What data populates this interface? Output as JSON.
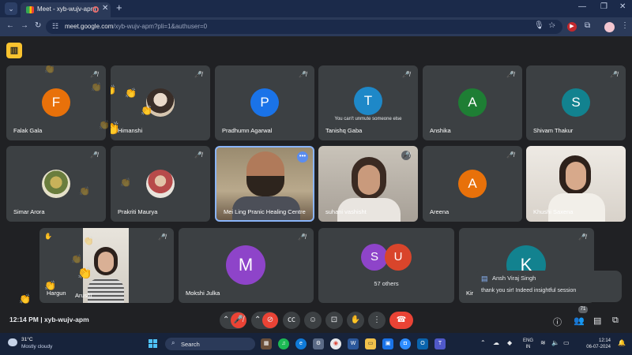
{
  "browser": {
    "tab_title": "Meet - xyb-wujv-apm",
    "url_host": "meet.google.com",
    "url_path": "/xyb-wujv-apm?pli=1&authuser=0"
  },
  "tiles": [
    {
      "id": "falak",
      "name": "Falak Gala",
      "initial": "F",
      "color": "#e8710a"
    },
    {
      "id": "himanshi",
      "name": "Himanshi"
    },
    {
      "id": "pradhumn",
      "name": "Pradhumn Agarwal",
      "initial": "P",
      "color": "#1a73e8"
    },
    {
      "id": "tanishq",
      "name": "Tanishq Gaba",
      "initial": "T",
      "color": "#1e88c8",
      "overlay": "You can't unmute someone else"
    },
    {
      "id": "anshika",
      "name": "Anshika",
      "initial": "A",
      "color": "#1e7e34"
    },
    {
      "id": "shivam",
      "name": "Shivam Thakur",
      "initial": "S",
      "color": "#12828f"
    },
    {
      "id": "simar",
      "name": "Simar Arora"
    },
    {
      "id": "prakriti",
      "name": "Prakriti Maurya"
    },
    {
      "id": "mei",
      "name": "Mei Ling Pranic Healing Centre"
    },
    {
      "id": "suhani",
      "name": "suhani vashisht"
    },
    {
      "id": "areena",
      "name": "Areena",
      "initial": "A",
      "color": "#e8710a"
    },
    {
      "id": "khushi",
      "name": "Khushi Saxena"
    },
    {
      "id": "hargun",
      "name": "Hargun"
    },
    {
      "id": "arushi",
      "name": "Arushi"
    },
    {
      "id": "mokshi",
      "name": "Mokshi Julka",
      "initial": "M",
      "color": "#8e44c9"
    },
    {
      "id": "others",
      "name": "57 others",
      "initial_a": "S",
      "color_a": "#8e44c9",
      "initial_b": "U",
      "color_b": "#d9452b"
    },
    {
      "id": "kir",
      "name": "Kir",
      "initial": "K",
      "color": "#12828f"
    }
  ],
  "chat_popup": {
    "sender": "Ansh Viraj Singh",
    "message": "thank you sir! Indeed insightful session"
  },
  "bottom_bar": {
    "time_code": "12:14 PM  |  xyb-wujv-apm",
    "people_count": "71"
  },
  "taskbar": {
    "temperature": "31°C",
    "weather": "Mostly cloudy",
    "search_label": "Search",
    "lang_line1": "ENG",
    "lang_line2": "IN",
    "clock_time": "12:14",
    "clock_date": "06-07-2024"
  },
  "colors": {
    "meet_bg": "#202124",
    "tile_bg": "#3c4043",
    "end_call": "#ea4335",
    "raise_hand_badge": "#f9c32f",
    "browser_frame": "#1b2a4a"
  }
}
